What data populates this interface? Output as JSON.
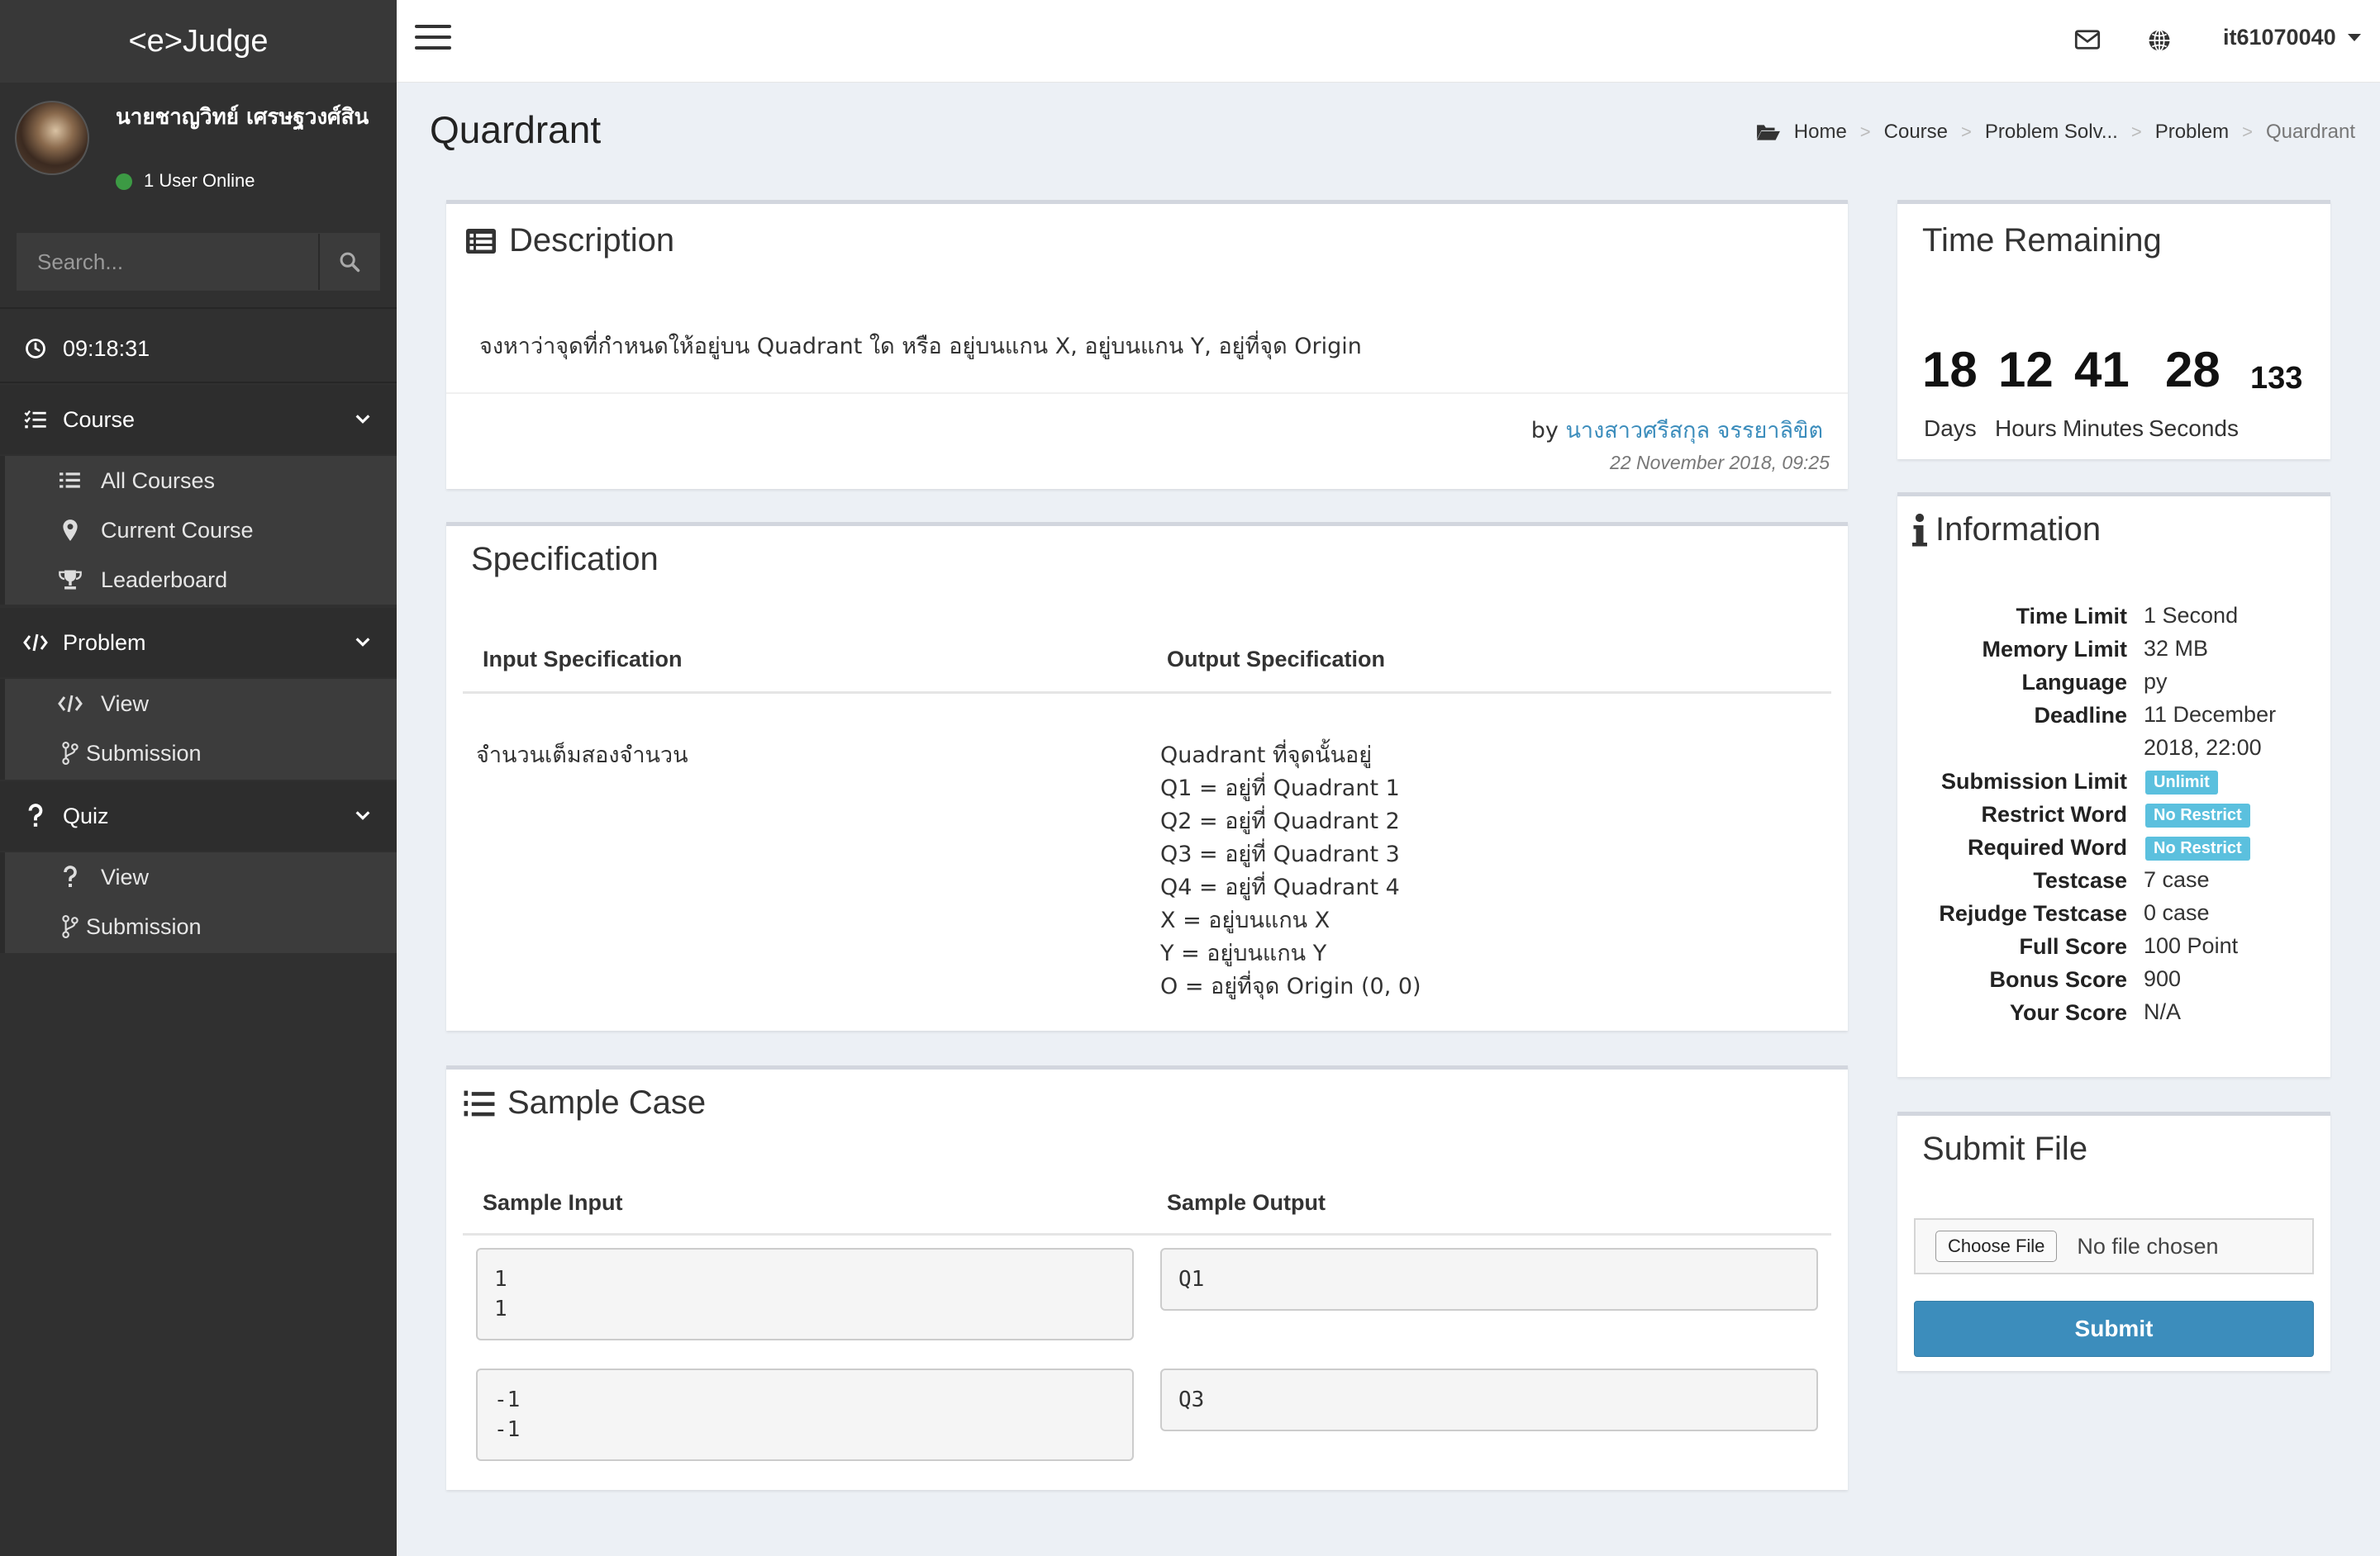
{
  "app": {
    "logo": "<e>Judge"
  },
  "user": {
    "name": "นายชาญวิทย์ เศรษฐวงศ์สิน",
    "online": "1 User Online",
    "username": "it61070040"
  },
  "search": {
    "placeholder": "Search..."
  },
  "clock": {
    "time": "09:18:31"
  },
  "sidebar": {
    "course": {
      "label": "Course",
      "items": [
        "All Courses",
        "Current Course",
        "Leaderboard"
      ]
    },
    "problem": {
      "label": "Problem",
      "items": [
        "View",
        "Submission"
      ]
    },
    "quiz": {
      "label": "Quiz",
      "items": [
        "View",
        "Submission"
      ]
    }
  },
  "page": {
    "title": "Quardrant"
  },
  "breadcrumb": [
    "Home",
    "Course",
    "Problem Solv...",
    "Problem",
    "Quardrant"
  ],
  "description": {
    "title": "Description",
    "text": "จงหาว่าจุดที่กำหนดให้อยู่บน Quadrant ใด หรือ อยู่บนแกน X, อยู่บนแกน Y, อยู่ที่จุด Origin",
    "by_prefix": "by",
    "author": "นางสาวศรีสกุล จรรยาลิขิต",
    "date": "22 November 2018, 09:25"
  },
  "specification": {
    "title": "Specification",
    "input_header": "Input Specification",
    "output_header": "Output Specification",
    "input_text": "จำนวนเต็มสองจำนวน",
    "output_lines": [
      "Quadrant ที่จุดนั้นอยู่",
      "Q1 = อยู่ที่ Quadrant 1",
      "Q2 = อยู่ที่ Quadrant 2",
      "Q3 = อยู่ที่ Quadrant 3",
      "Q4 = อยู่ที่ Quadrant 4",
      "X = อยู่บนแกน X",
      "Y = อยู่บนแกน Y",
      "O = อยู่ที่จุด Origin (0, 0)"
    ]
  },
  "sample": {
    "title": "Sample Case",
    "input_header": "Sample Input",
    "output_header": "Sample Output",
    "cases": [
      {
        "input": "1\n1",
        "output": "Q1"
      },
      {
        "input": "-1\n-1",
        "output": "Q3"
      }
    ]
  },
  "time_remaining": {
    "title": "Time Remaining",
    "days": "18",
    "hours": "12",
    "minutes": "41",
    "seconds": "28",
    "ms": "133",
    "labels": {
      "days": "Days",
      "hours": "Hours",
      "minutes": "Minutes",
      "seconds": "Seconds"
    }
  },
  "information": {
    "title": "Information",
    "rows": {
      "time_limit": {
        "key": "Time Limit",
        "value": "1 Second"
      },
      "memory_limit": {
        "key": "Memory Limit",
        "value": "32 MB"
      },
      "language": {
        "key": "Language",
        "value": "py"
      },
      "deadline": {
        "key": "Deadline",
        "value": "11 December 2018, 22:00"
      },
      "submission_limit": {
        "key": "Submission Limit",
        "value": "Unlimit"
      },
      "restrict_word": {
        "key": "Restrict Word",
        "value": "No Restrict"
      },
      "required_word": {
        "key": "Required Word",
        "value": "No Restrict"
      },
      "testcase": {
        "key": "Testcase",
        "value": "7 case"
      },
      "rejudge_testcase": {
        "key": "Rejudge Testcase",
        "value": "0 case"
      },
      "full_score": {
        "key": "Full Score",
        "value": "100 Point"
      },
      "bonus_score": {
        "key": "Bonus Score",
        "value": "900"
      },
      "your_score": {
        "key": "Your Score",
        "value": "N/A"
      }
    }
  },
  "submit": {
    "title": "Submit File",
    "choose_label": "Choose File",
    "file_status": "No file chosen",
    "submit_label": "Submit"
  },
  "colors": {
    "sidebar": "#303030",
    "accent": "#3c8dbc",
    "badge": "#5bc0de",
    "online": "#3c9a44"
  }
}
